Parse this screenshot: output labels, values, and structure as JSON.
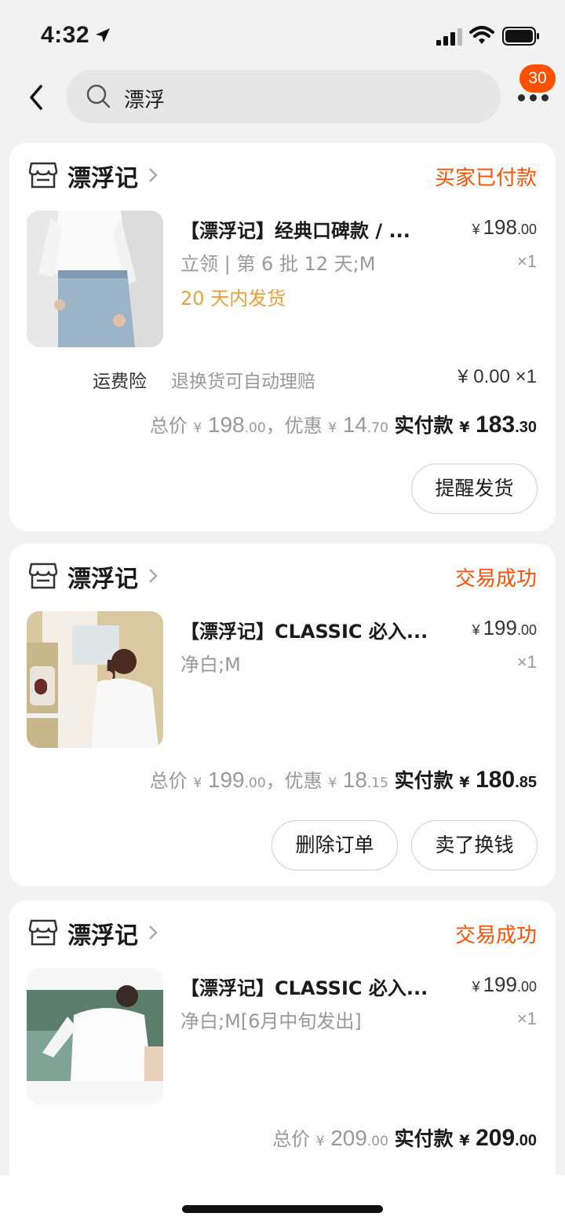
{
  "status_bar": {
    "time": "4:32"
  },
  "nav": {
    "search_text": "漂浮",
    "notification_count": "30"
  },
  "orders": [
    {
      "shop": "漂浮记",
      "status": "买家已付款",
      "title": "【漂浮记】经典口碑款 / ...",
      "price_int": "198",
      "price_dec": ".00",
      "sku": "立领 | 第 6 批 12 天;M",
      "qty": "×1",
      "ship_note": "20 天内发货",
      "insurance_label": "运费险",
      "insurance_desc": "退换货可自动理赔",
      "insurance_price": "¥ 0.00 ×1",
      "total_label": "总价",
      "total_int": "198",
      "total_dec": ".00",
      "discount_label": "，优惠",
      "discount_int": "14",
      "discount_dec": ".70",
      "paid_label": "实付款",
      "paid_int": "183",
      "paid_dec": ".30",
      "buttons": [
        "提醒发货"
      ]
    },
    {
      "shop": "漂浮记",
      "status": "交易成功",
      "title": "【漂浮记】CLASSIC 必入...",
      "price_int": "199",
      "price_dec": ".00",
      "sku": "净白;M",
      "qty": "×1",
      "total_label": "总价",
      "total_int": "199",
      "total_dec": ".00",
      "discount_label": "，优惠",
      "discount_int": "18",
      "discount_dec": ".15",
      "paid_label": "实付款",
      "paid_int": "180",
      "paid_dec": ".85",
      "buttons": [
        "删除订单",
        "卖了换钱"
      ]
    },
    {
      "shop": "漂浮记",
      "status": "交易成功",
      "title": "【漂浮记】CLASSIC 必入...",
      "price_int": "199",
      "price_dec": ".00",
      "sku": "净白;M[6月中旬发出]",
      "qty": "×1",
      "total_label": "总价",
      "total_int": "209",
      "total_dec": ".00",
      "paid_label": "实付款",
      "paid_int": "209",
      "paid_dec": ".00"
    }
  ],
  "currency_symbol": "¥",
  "colors": {
    "accent": "#ff5000",
    "ship_note": "#e8a23a",
    "background": "#f2f2f2"
  }
}
